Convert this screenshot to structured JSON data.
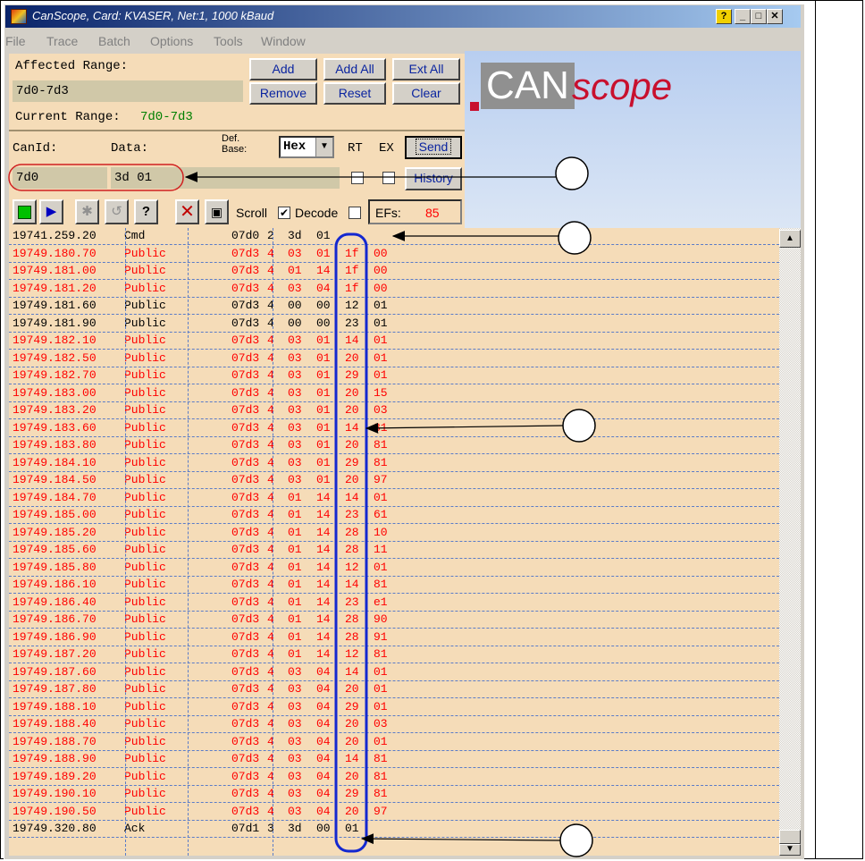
{
  "window": {
    "title": "CanScope, Card: KVASER, Net:1, 1000 kBaud",
    "help_icon": "help-icon",
    "minimize_icon": "minimize-icon",
    "maximize_icon": "maximize-icon",
    "close_icon": "close-icon"
  },
  "menu": [
    "File",
    "Trace",
    "Batch",
    "Options",
    "Tools",
    "Window"
  ],
  "range": {
    "affected_label": "Affected Range:",
    "affected_value": "7d0-7d3",
    "current_label": "Current Range:",
    "current_value": "7d0-7d3",
    "buttons": {
      "add": "Add",
      "add_all": "Add All",
      "ext_all": "Ext All",
      "remove": "Remove",
      "reset": "Reset",
      "clear": "Clear"
    }
  },
  "logo": {
    "part1": "CAN",
    "part2": "scope"
  },
  "send": {
    "canid_label": "CanId:",
    "data_label": "Data:",
    "defbase_label_1": "Def.",
    "defbase_label_2": "Base:",
    "base_value": "Hex",
    "rt_label": "RT",
    "ex_label": "EX",
    "send_button": "Send",
    "history_button": "History",
    "canid_value": "7d0",
    "data_value": "3d 01"
  },
  "toolbar": {
    "scroll_label": "Scroll",
    "scroll_checked": true,
    "decode_label": "Decode",
    "decode_checked": false,
    "efs_label": "EFs:",
    "efs_value": "85"
  },
  "colors": {
    "normal": "#000000",
    "error": "#ff0000",
    "green_text": "#008000",
    "highlight": "#1428d0"
  },
  "trace_rows": [
    {
      "time": "19741.259.20",
      "type": "Cmd",
      "id": "07d0",
      "dlc": "2",
      "b1": "3d",
      "b2": "01",
      "b3": "",
      "b4": "",
      "color": "#000000"
    },
    {
      "time": "19749.180.70",
      "type": "Public",
      "id": "07d3",
      "dlc": "4",
      "b1": "03",
      "b2": "01",
      "b3": "1f",
      "b4": "00",
      "color": "#ff0000"
    },
    {
      "time": "19749.181.00",
      "type": "Public",
      "id": "07d3",
      "dlc": "4",
      "b1": "01",
      "b2": "14",
      "b3": "1f",
      "b4": "00",
      "color": "#ff0000"
    },
    {
      "time": "19749.181.20",
      "type": "Public",
      "id": "07d3",
      "dlc": "4",
      "b1": "03",
      "b2": "04",
      "b3": "1f",
      "b4": "00",
      "color": "#ff0000"
    },
    {
      "time": "19749.181.60",
      "type": "Public",
      "id": "07d3",
      "dlc": "4",
      "b1": "00",
      "b2": "00",
      "b3": "12",
      "b4": "01",
      "color": "#000000"
    },
    {
      "time": "19749.181.90",
      "type": "Public",
      "id": "07d3",
      "dlc": "4",
      "b1": "00",
      "b2": "00",
      "b3": "23",
      "b4": "01",
      "color": "#000000"
    },
    {
      "time": "19749.182.10",
      "type": "Public",
      "id": "07d3",
      "dlc": "4",
      "b1": "03",
      "b2": "01",
      "b3": "14",
      "b4": "01",
      "color": "#ff0000"
    },
    {
      "time": "19749.182.50",
      "type": "Public",
      "id": "07d3",
      "dlc": "4",
      "b1": "03",
      "b2": "01",
      "b3": "20",
      "b4": "01",
      "color": "#ff0000"
    },
    {
      "time": "19749.182.70",
      "type": "Public",
      "id": "07d3",
      "dlc": "4",
      "b1": "03",
      "b2": "01",
      "b3": "29",
      "b4": "01",
      "color": "#ff0000"
    },
    {
      "time": "19749.183.00",
      "type": "Public",
      "id": "07d3",
      "dlc": "4",
      "b1": "03",
      "b2": "01",
      "b3": "20",
      "b4": "15",
      "color": "#ff0000"
    },
    {
      "time": "19749.183.20",
      "type": "Public",
      "id": "07d3",
      "dlc": "4",
      "b1": "03",
      "b2": "01",
      "b3": "20",
      "b4": "03",
      "color": "#ff0000"
    },
    {
      "time": "19749.183.60",
      "type": "Public",
      "id": "07d3",
      "dlc": "4",
      "b1": "03",
      "b2": "01",
      "b3": "14",
      "b4": "81",
      "color": "#ff0000"
    },
    {
      "time": "19749.183.80",
      "type": "Public",
      "id": "07d3",
      "dlc": "4",
      "b1": "03",
      "b2": "01",
      "b3": "20",
      "b4": "81",
      "color": "#ff0000"
    },
    {
      "time": "19749.184.10",
      "type": "Public",
      "id": "07d3",
      "dlc": "4",
      "b1": "03",
      "b2": "01",
      "b3": "29",
      "b4": "81",
      "color": "#ff0000"
    },
    {
      "time": "19749.184.50",
      "type": "Public",
      "id": "07d3",
      "dlc": "4",
      "b1": "03",
      "b2": "01",
      "b3": "20",
      "b4": "97",
      "color": "#ff0000"
    },
    {
      "time": "19749.184.70",
      "type": "Public",
      "id": "07d3",
      "dlc": "4",
      "b1": "01",
      "b2": "14",
      "b3": "14",
      "b4": "01",
      "color": "#ff0000"
    },
    {
      "time": "19749.185.00",
      "type": "Public",
      "id": "07d3",
      "dlc": "4",
      "b1": "01",
      "b2": "14",
      "b3": "23",
      "b4": "61",
      "color": "#ff0000"
    },
    {
      "time": "19749.185.20",
      "type": "Public",
      "id": "07d3",
      "dlc": "4",
      "b1": "01",
      "b2": "14",
      "b3": "28",
      "b4": "10",
      "color": "#ff0000"
    },
    {
      "time": "19749.185.60",
      "type": "Public",
      "id": "07d3",
      "dlc": "4",
      "b1": "01",
      "b2": "14",
      "b3": "28",
      "b4": "11",
      "color": "#ff0000"
    },
    {
      "time": "19749.185.80",
      "type": "Public",
      "id": "07d3",
      "dlc": "4",
      "b1": "01",
      "b2": "14",
      "b3": "12",
      "b4": "01",
      "color": "#ff0000"
    },
    {
      "time": "19749.186.10",
      "type": "Public",
      "id": "07d3",
      "dlc": "4",
      "b1": "01",
      "b2": "14",
      "b3": "14",
      "b4": "81",
      "color": "#ff0000"
    },
    {
      "time": "19749.186.40",
      "type": "Public",
      "id": "07d3",
      "dlc": "4",
      "b1": "01",
      "b2": "14",
      "b3": "23",
      "b4": "e1",
      "color": "#ff0000"
    },
    {
      "time": "19749.186.70",
      "type": "Public",
      "id": "07d3",
      "dlc": "4",
      "b1": "01",
      "b2": "14",
      "b3": "28",
      "b4": "90",
      "color": "#ff0000"
    },
    {
      "time": "19749.186.90",
      "type": "Public",
      "id": "07d3",
      "dlc": "4",
      "b1": "01",
      "b2": "14",
      "b3": "28",
      "b4": "91",
      "color": "#ff0000"
    },
    {
      "time": "19749.187.20",
      "type": "Public",
      "id": "07d3",
      "dlc": "4",
      "b1": "01",
      "b2": "14",
      "b3": "12",
      "b4": "81",
      "color": "#ff0000"
    },
    {
      "time": "19749.187.60",
      "type": "Public",
      "id": "07d3",
      "dlc": "4",
      "b1": "03",
      "b2": "04",
      "b3": "14",
      "b4": "01",
      "color": "#ff0000"
    },
    {
      "time": "19749.187.80",
      "type": "Public",
      "id": "07d3",
      "dlc": "4",
      "b1": "03",
      "b2": "04",
      "b3": "20",
      "b4": "01",
      "color": "#ff0000"
    },
    {
      "time": "19749.188.10",
      "type": "Public",
      "id": "07d3",
      "dlc": "4",
      "b1": "03",
      "b2": "04",
      "b3": "29",
      "b4": "01",
      "color": "#ff0000"
    },
    {
      "time": "19749.188.40",
      "type": "Public",
      "id": "07d3",
      "dlc": "4",
      "b1": "03",
      "b2": "04",
      "b3": "20",
      "b4": "03",
      "color": "#ff0000"
    },
    {
      "time": "19749.188.70",
      "type": "Public",
      "id": "07d3",
      "dlc": "4",
      "b1": "03",
      "b2": "04",
      "b3": "20",
      "b4": "01",
      "color": "#ff0000"
    },
    {
      "time": "19749.188.90",
      "type": "Public",
      "id": "07d3",
      "dlc": "4",
      "b1": "03",
      "b2": "04",
      "b3": "14",
      "b4": "81",
      "color": "#ff0000"
    },
    {
      "time": "19749.189.20",
      "type": "Public",
      "id": "07d3",
      "dlc": "4",
      "b1": "03",
      "b2": "04",
      "b3": "20",
      "b4": "81",
      "color": "#ff0000"
    },
    {
      "time": "19749.190.10",
      "type": "Public",
      "id": "07d3",
      "dlc": "4",
      "b1": "03",
      "b2": "04",
      "b3": "29",
      "b4": "81",
      "color": "#ff0000"
    },
    {
      "time": "19749.190.50",
      "type": "Public",
      "id": "07d3",
      "dlc": "4",
      "b1": "03",
      "b2": "04",
      "b3": "20",
      "b4": "97",
      "color": "#ff0000"
    },
    {
      "time": "19749.320.80",
      "type": "Ack",
      "id": "07d1",
      "dlc": "3",
      "b1": "3d",
      "b2": "00",
      "b3": "01",
      "b4": "",
      "color": "#000000"
    }
  ]
}
